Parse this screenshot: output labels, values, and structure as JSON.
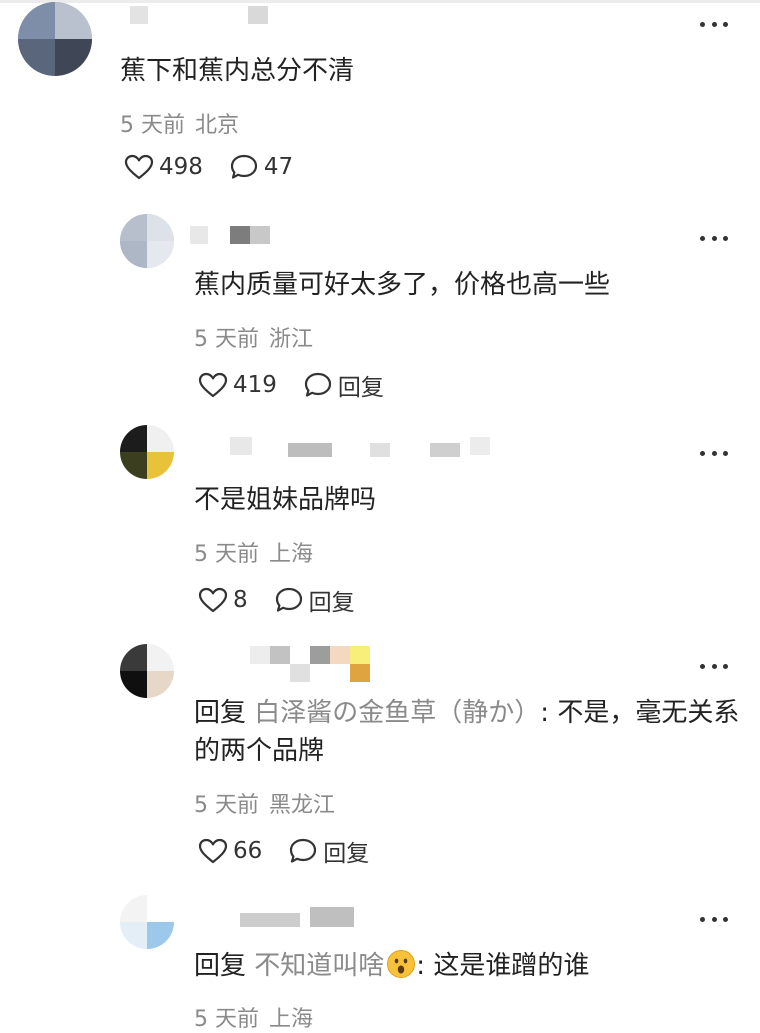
{
  "comments": [
    {
      "text": "蕉下和蕉内总分不清",
      "time": "5 天前",
      "location": "北京",
      "likes": "498",
      "replies": "47"
    },
    {
      "text": "蕉内质量可好太多了，价格也高一些",
      "time": "5 天前",
      "location": "浙江",
      "likes": "419",
      "reply_label": "回复"
    },
    {
      "text": "不是姐妹品牌吗",
      "time": "5 天前",
      "location": "上海",
      "likes": "8",
      "reply_label": "回复"
    },
    {
      "reply_prefix": "回复",
      "reply_target": "白泽酱の金鱼草（静か）",
      "text": ": 不是，毫无关系的两个品牌",
      "time": "5 天前",
      "location": "黑龙江",
      "likes": "66",
      "reply_label": "回复"
    },
    {
      "reply_prefix": "回复",
      "reply_target": "不知道叫啥",
      "text": ": 这是谁蹭的谁",
      "time": "5 天前",
      "location": "上海",
      "emoji_icon": "surprised-face-emoji"
    }
  ],
  "colors": {
    "meta_text": "#8a8a8a",
    "body_text": "#222222",
    "reply_target": "#8a8a8a"
  }
}
